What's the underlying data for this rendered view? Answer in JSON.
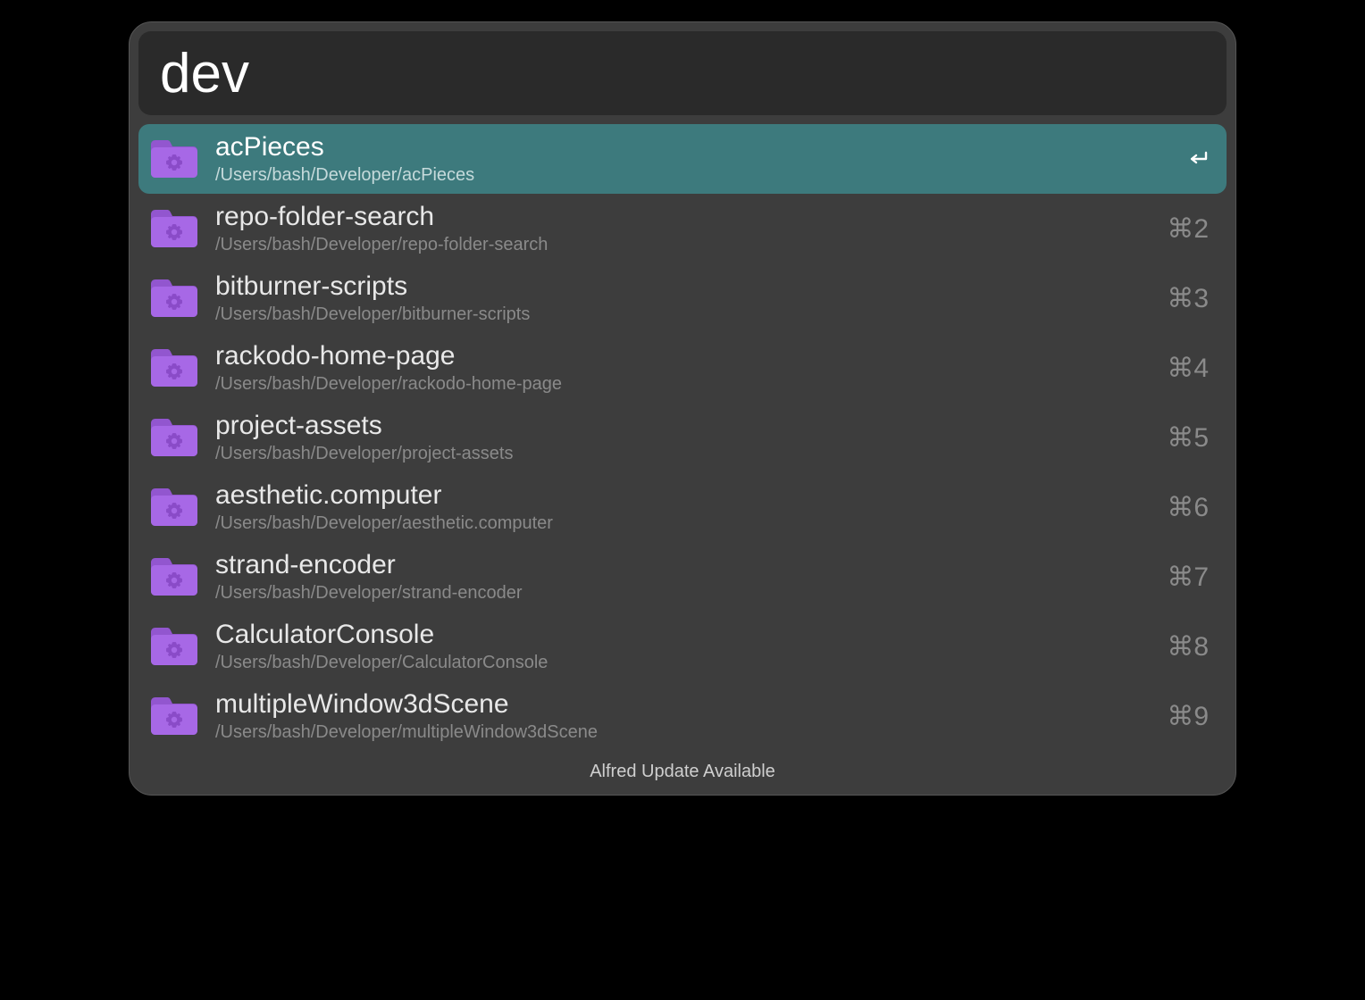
{
  "search": {
    "value": "dev"
  },
  "results": [
    {
      "title": "acPieces",
      "subtitle": "/Users/bash/Developer/acPieces",
      "shortcut": "",
      "selected": true
    },
    {
      "title": "repo-folder-search",
      "subtitle": "/Users/bash/Developer/repo-folder-search",
      "shortcut": "⌘2",
      "selected": false
    },
    {
      "title": "bitburner-scripts",
      "subtitle": "/Users/bash/Developer/bitburner-scripts",
      "shortcut": "⌘3",
      "selected": false
    },
    {
      "title": "rackodo-home-page",
      "subtitle": "/Users/bash/Developer/rackodo-home-page",
      "shortcut": "⌘4",
      "selected": false
    },
    {
      "title": "project-assets",
      "subtitle": "/Users/bash/Developer/project-assets",
      "shortcut": "⌘5",
      "selected": false
    },
    {
      "title": "aesthetic.computer",
      "subtitle": "/Users/bash/Developer/aesthetic.computer",
      "shortcut": "⌘6",
      "selected": false
    },
    {
      "title": "strand-encoder",
      "subtitle": "/Users/bash/Developer/strand-encoder",
      "shortcut": "⌘7",
      "selected": false
    },
    {
      "title": "CalculatorConsole",
      "subtitle": "/Users/bash/Developer/CalculatorConsole",
      "shortcut": "⌘8",
      "selected": false
    },
    {
      "title": "multipleWindow3dScene",
      "subtitle": "/Users/bash/Developer/multipleWindow3dScene",
      "shortcut": "⌘9",
      "selected": false
    }
  ],
  "footer": {
    "message": "Alfred Update Available"
  },
  "colors": {
    "folder_body": "#a768e6",
    "folder_tab": "#9256cf",
    "gear": "#8a4bc8"
  }
}
